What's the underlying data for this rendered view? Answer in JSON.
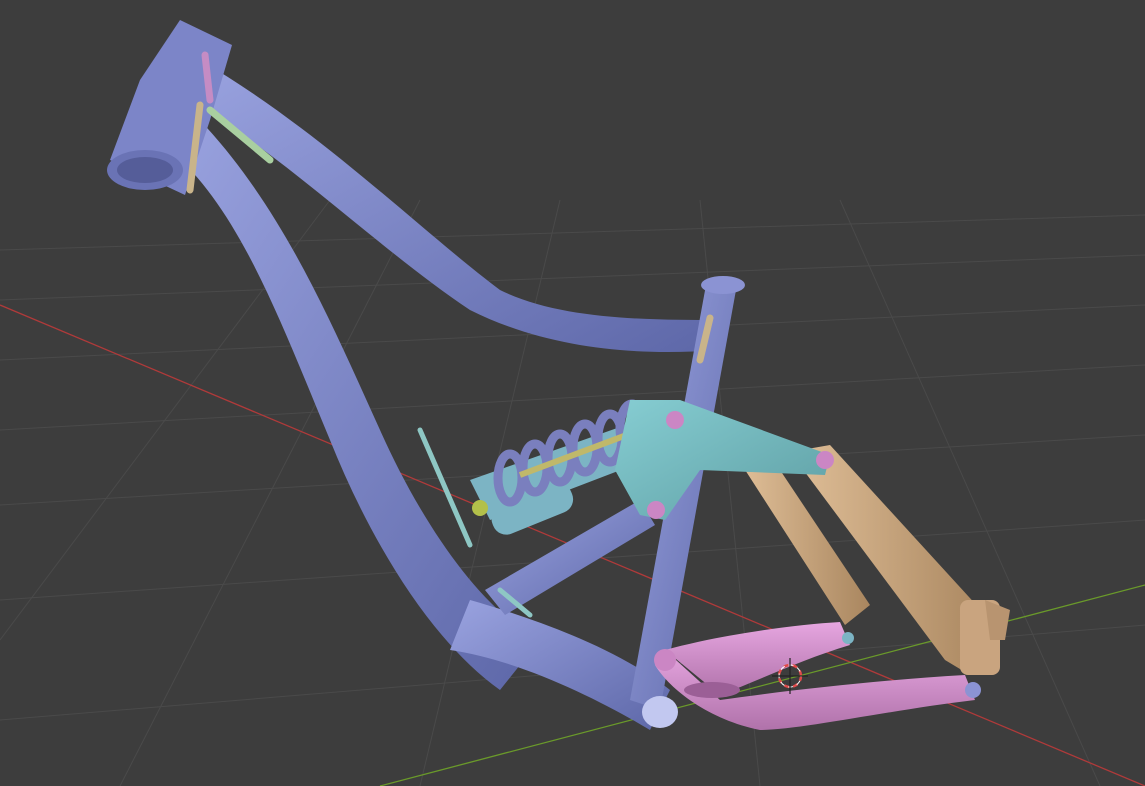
{
  "viewport": {
    "mode": "3D viewport",
    "background_color": "#3d3d3d",
    "grid_color": "#4a4a4a",
    "x_axis_color": "#b03a3a",
    "y_axis_color": "#6a9a2a"
  },
  "model": {
    "name": "bike-frame",
    "parts": [
      {
        "name": "front-triangle",
        "color": "#7580c6"
      },
      {
        "name": "swingarm-upper-link",
        "color": "#6fb0b5"
      },
      {
        "name": "seat-stays",
        "color": "#c9a47f"
      },
      {
        "name": "chain-stays",
        "color": "#cb86c4"
      },
      {
        "name": "shock-spring",
        "color": "#7a7fbe"
      },
      {
        "name": "shock-body",
        "color": "#7cb4c4"
      },
      {
        "name": "weld-beads",
        "color": "#c9b48a"
      }
    ]
  },
  "cursor_3d": {
    "icon": "3d-cursor-icon",
    "ring_color": "#e04a4a"
  }
}
